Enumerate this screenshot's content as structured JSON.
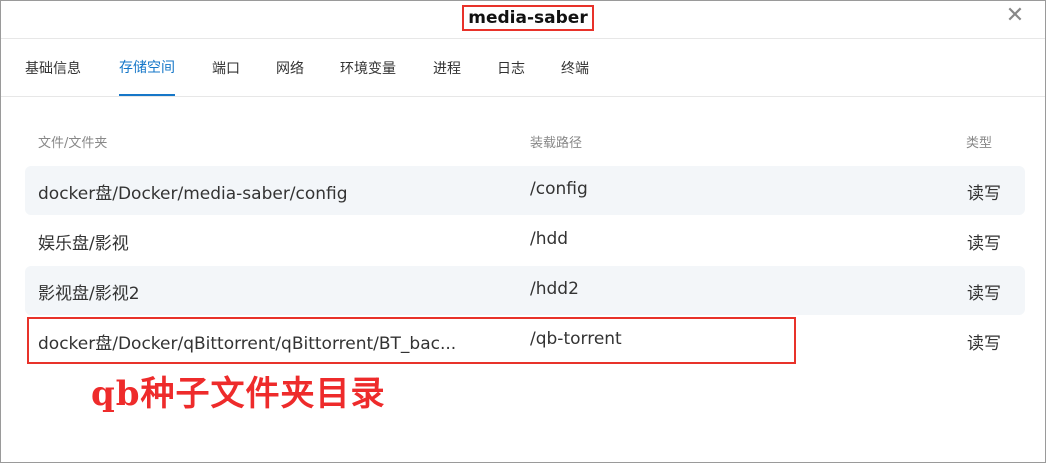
{
  "window": {
    "title": "media-saber",
    "close_symbol": "✕"
  },
  "tabs": [
    {
      "label": "基础信息"
    },
    {
      "label": "存储空间",
      "active": true
    },
    {
      "label": "端口"
    },
    {
      "label": "网络"
    },
    {
      "label": "环境变量"
    },
    {
      "label": "进程"
    },
    {
      "label": "日志"
    },
    {
      "label": "终端"
    }
  ],
  "table": {
    "headers": {
      "path": "文件/文件夹",
      "mount": "装载路径",
      "type": "类型"
    },
    "rows": [
      {
        "path": "docker盘/Docker/media-saber/config",
        "mount": "/config",
        "type": "读写"
      },
      {
        "path": "娱乐盘/影视",
        "mount": "/hdd",
        "type": "读写"
      },
      {
        "path": "影视盘/影视2",
        "mount": "/hdd2",
        "type": "读写"
      },
      {
        "path": "docker盘/Docker/qBittorrent/qBittorrent/BT_bac...",
        "mount": "/qb-torrent",
        "type": "读写"
      }
    ]
  },
  "annotation": {
    "text": "qb种子文件夹目录",
    "color": "#ee2b2b"
  },
  "colors": {
    "accent": "#1677c8",
    "highlight": "#e8322a",
    "row_alt": "#f3f6f9"
  }
}
